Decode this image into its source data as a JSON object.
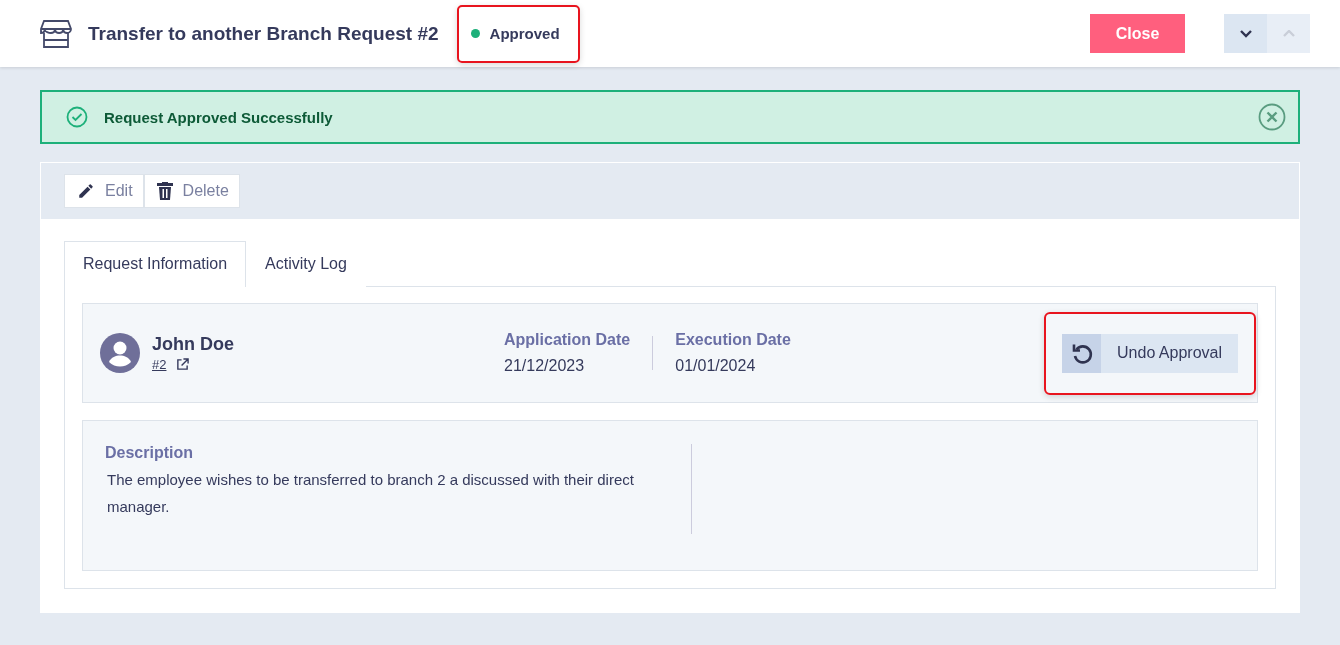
{
  "header": {
    "title": "Transfer to another Branch Request #2",
    "status": {
      "label": "Approved",
      "color": "#1db07a",
      "highlighted": true
    },
    "close_button": "Close",
    "nav_buttons": [
      {
        "kind": "down",
        "disabled": false
      },
      {
        "kind": "up",
        "disabled": true
      }
    ]
  },
  "alert": {
    "message": "Request Approved Successfully"
  },
  "toolbar": [
    {
      "kind": "edit",
      "label": "Edit"
    },
    {
      "kind": "delete",
      "label": "Delete"
    }
  ],
  "tabs": [
    {
      "label": "Request Information",
      "selected": true
    },
    {
      "label": "Activity Log",
      "selected": false
    }
  ],
  "employee": {
    "name": "John Doe",
    "number": "#2"
  },
  "dates": [
    {
      "label": "Application Date",
      "value": "21/12/2023"
    },
    {
      "label": "Execution Date",
      "value": "01/01/2024"
    }
  ],
  "undo_button": {
    "label": "Undo Approval",
    "highlighted": true
  },
  "description": {
    "label": "Description",
    "text": "The employee wishes to be transferred to branch 2 a discussed with their direct manager."
  }
}
